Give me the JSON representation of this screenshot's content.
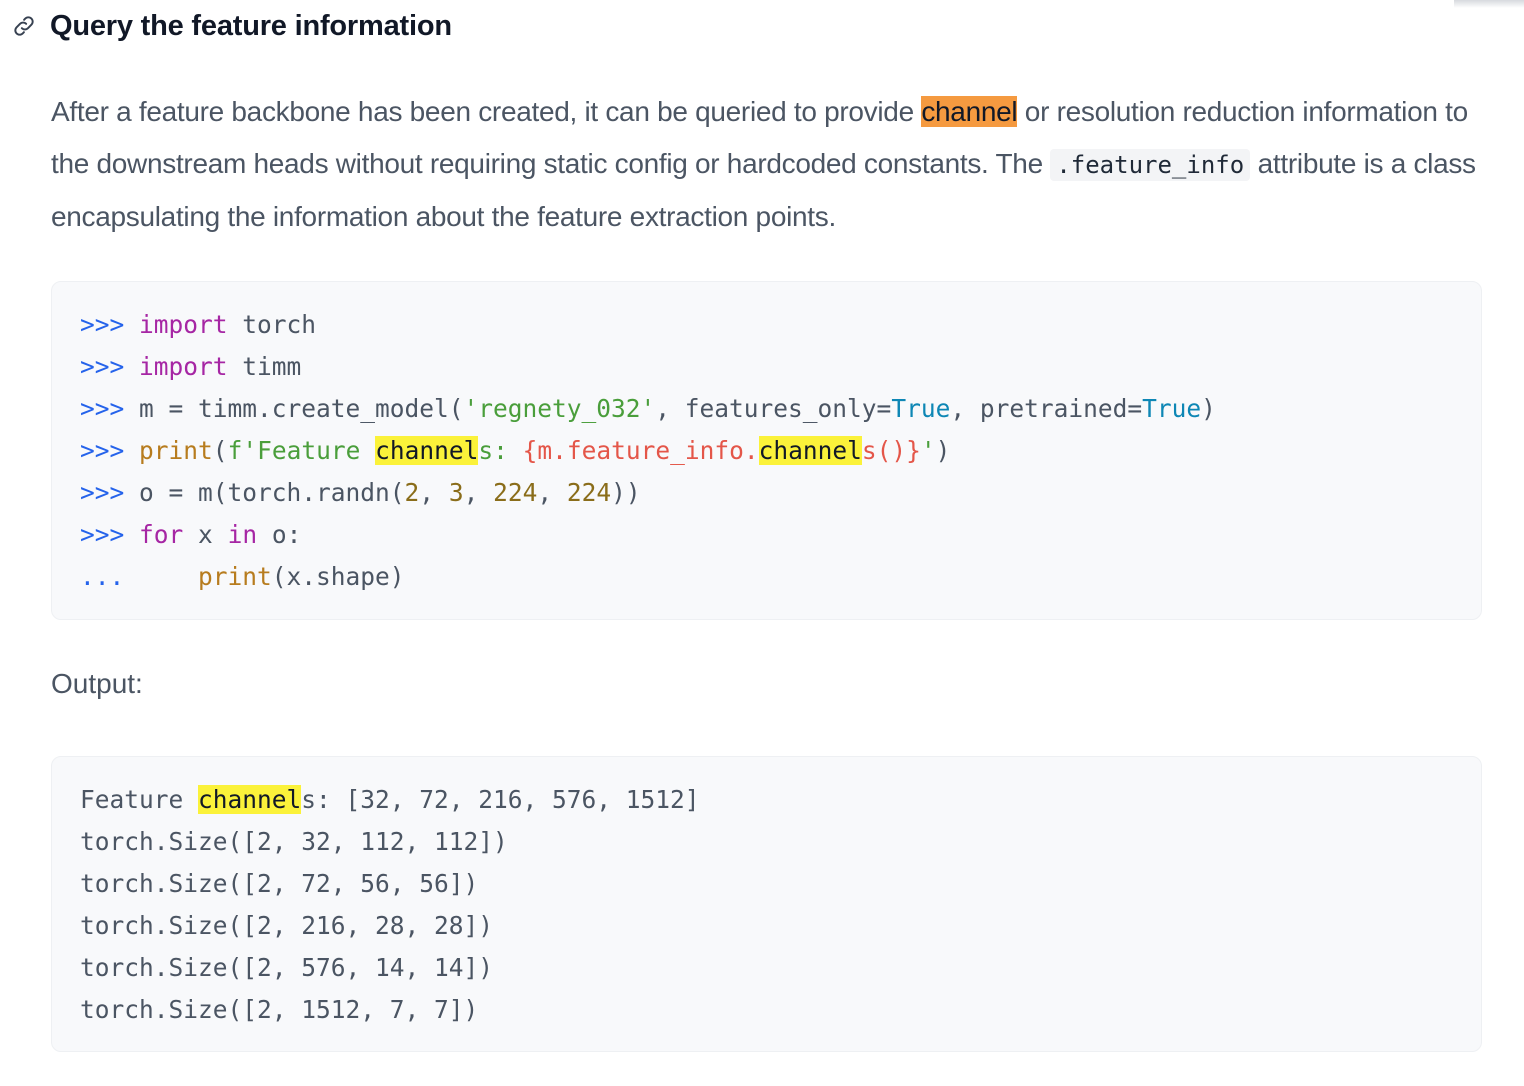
{
  "section": {
    "title": "Query the feature information",
    "link_icon": "link-icon"
  },
  "paragraph": {
    "part1": "After a feature backbone has been created, it can be queried to provide ",
    "highlight": "channel",
    "part2": " or resolution reduction information to the downstream heads without requiring static config or hardcoded constants. The ",
    "inline_code": ".feature_info",
    "part3": " attribute is a class encapsulating the information about the feature extraction points."
  },
  "code": {
    "prompt": ">>>",
    "continuation": "...",
    "l1": {
      "kw": "import",
      "rest": " torch"
    },
    "l2": {
      "kw": "import",
      "rest": " timm"
    },
    "l3": {
      "a": " m = timm.create_model(",
      "str": "'regnety_032'",
      "b": ", features_only=",
      "true1": "True",
      "c": ", pretrained=",
      "true2": "True",
      "d": ")"
    },
    "l4": {
      "fn": "print",
      "a": "(",
      "s1": "f'Feature ",
      "hl1": "channel",
      "s2": "s: ",
      "e1": "{m.feature_info.",
      "hl2": "channel",
      "e2": "s()}",
      "s3": "'",
      "b": ")"
    },
    "l5": {
      "a": " o = m(torch.randn(",
      "n1": "2",
      "c1": ", ",
      "n2": "3",
      "c2": ", ",
      "n3": "224",
      "c3": ", ",
      "n4": "224",
      "b": "))"
    },
    "l6": {
      "kw1": "for",
      "a": " x ",
      "kw2": "in",
      "b": " o:"
    },
    "l7": {
      "indent": "     ",
      "fn": "print",
      "a": "(x.shape)"
    }
  },
  "output_label": "Output:",
  "output": {
    "first_prefix": "Feature ",
    "first_highlight": "channel",
    "first_suffix": "s: [32, 72, 216, 576, 1512]",
    "lines": [
      "torch.Size([2, 32, 112, 112])",
      "torch.Size([2, 72, 56, 56])",
      "torch.Size([2, 216, 28, 28])",
      "torch.Size([2, 576, 14, 14])",
      "torch.Size([2, 1512, 7, 7])"
    ]
  }
}
